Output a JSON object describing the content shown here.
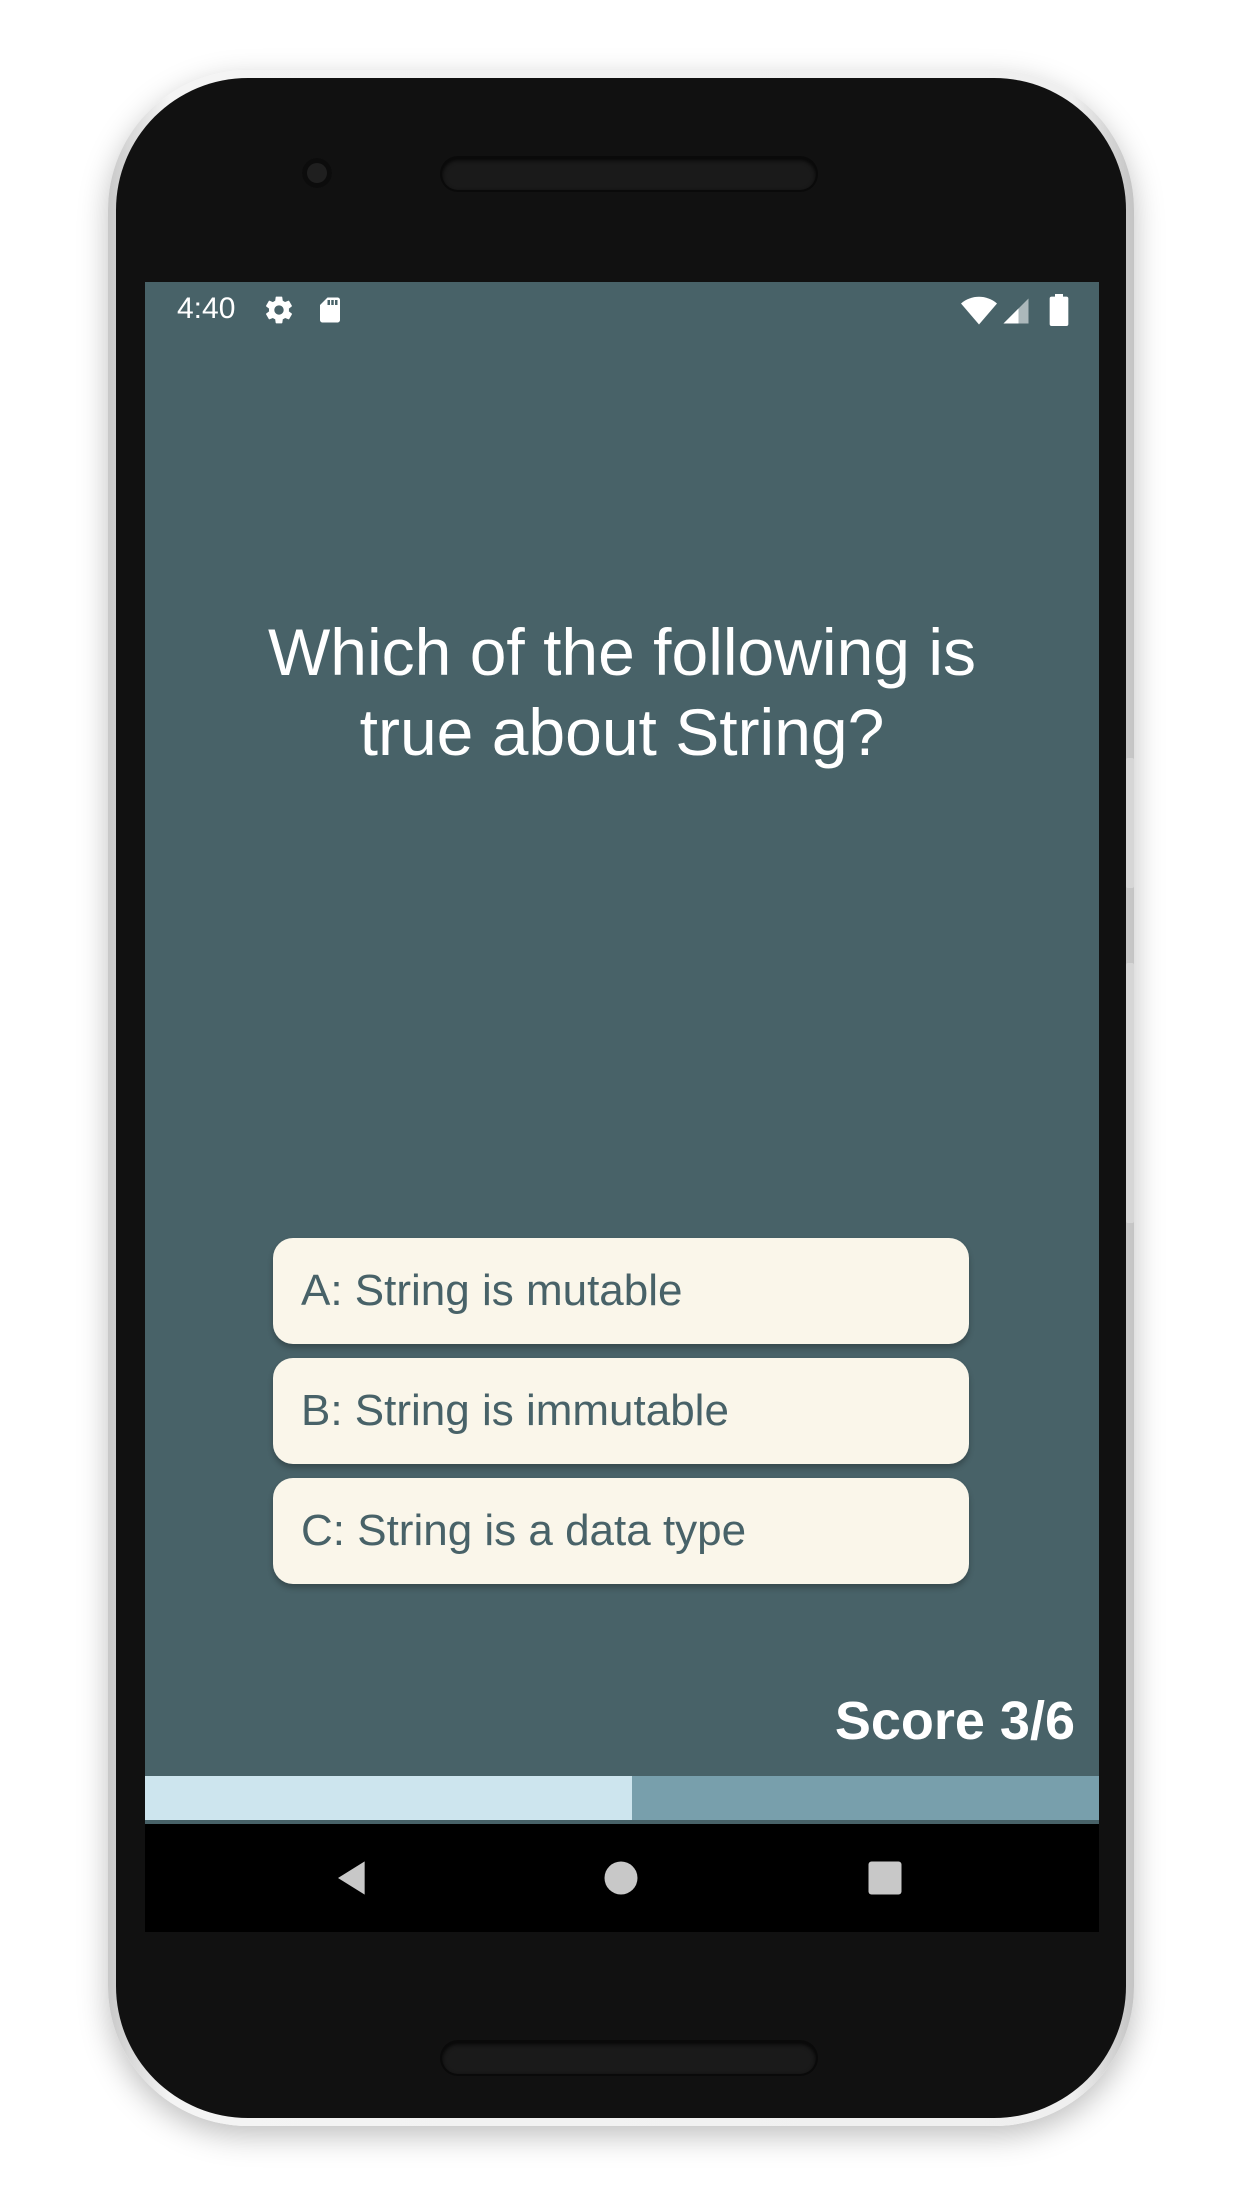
{
  "status_bar": {
    "time": "4:40",
    "left_icons": [
      "gear-icon",
      "sd-card-icon"
    ],
    "right_icons": [
      "wifi-icon",
      "cell-signal-icon",
      "battery-icon"
    ]
  },
  "quiz": {
    "question": "Which of the following is true about String?",
    "answers": [
      {
        "label": "A: String is mutable"
      },
      {
        "label": "B: String is immutable"
      },
      {
        "label": "C: String is a data type"
      }
    ],
    "score_text": "Score 3/6",
    "progress_fraction": 0.51
  },
  "nav_bar": {
    "buttons": [
      "back-icon",
      "home-icon",
      "recents-icon"
    ]
  },
  "colors": {
    "screen_background": "#486268",
    "answer_background": "#faf6ea",
    "answer_text": "#486268",
    "progress_fill": "#cde5ee",
    "progress_track": "#789fac"
  }
}
